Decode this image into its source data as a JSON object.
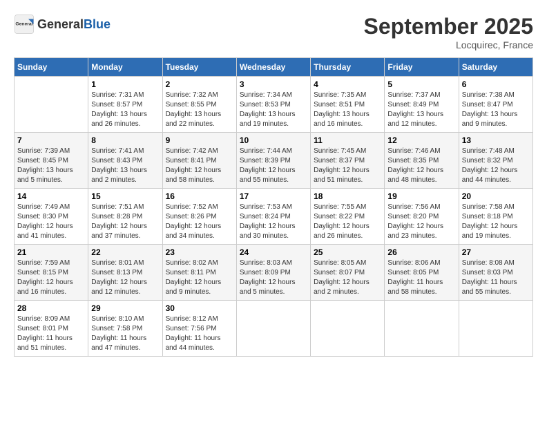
{
  "header": {
    "logo_general": "General",
    "logo_blue": "Blue",
    "month_title": "September 2025",
    "location": "Locquirec, France"
  },
  "days_of_week": [
    "Sunday",
    "Monday",
    "Tuesday",
    "Wednesday",
    "Thursday",
    "Friday",
    "Saturday"
  ],
  "weeks": [
    [
      {
        "day": "",
        "sunrise": "",
        "sunset": "",
        "daylight": ""
      },
      {
        "day": "1",
        "sunrise": "Sunrise: 7:31 AM",
        "sunset": "Sunset: 8:57 PM",
        "daylight": "Daylight: 13 hours and 26 minutes."
      },
      {
        "day": "2",
        "sunrise": "Sunrise: 7:32 AM",
        "sunset": "Sunset: 8:55 PM",
        "daylight": "Daylight: 13 hours and 22 minutes."
      },
      {
        "day": "3",
        "sunrise": "Sunrise: 7:34 AM",
        "sunset": "Sunset: 8:53 PM",
        "daylight": "Daylight: 13 hours and 19 minutes."
      },
      {
        "day": "4",
        "sunrise": "Sunrise: 7:35 AM",
        "sunset": "Sunset: 8:51 PM",
        "daylight": "Daylight: 13 hours and 16 minutes."
      },
      {
        "day": "5",
        "sunrise": "Sunrise: 7:37 AM",
        "sunset": "Sunset: 8:49 PM",
        "daylight": "Daylight: 13 hours and 12 minutes."
      },
      {
        "day": "6",
        "sunrise": "Sunrise: 7:38 AM",
        "sunset": "Sunset: 8:47 PM",
        "daylight": "Daylight: 13 hours and 9 minutes."
      }
    ],
    [
      {
        "day": "7",
        "sunrise": "Sunrise: 7:39 AM",
        "sunset": "Sunset: 8:45 PM",
        "daylight": "Daylight: 13 hours and 5 minutes."
      },
      {
        "day": "8",
        "sunrise": "Sunrise: 7:41 AM",
        "sunset": "Sunset: 8:43 PM",
        "daylight": "Daylight: 13 hours and 2 minutes."
      },
      {
        "day": "9",
        "sunrise": "Sunrise: 7:42 AM",
        "sunset": "Sunset: 8:41 PM",
        "daylight": "Daylight: 12 hours and 58 minutes."
      },
      {
        "day": "10",
        "sunrise": "Sunrise: 7:44 AM",
        "sunset": "Sunset: 8:39 PM",
        "daylight": "Daylight: 12 hours and 55 minutes."
      },
      {
        "day": "11",
        "sunrise": "Sunrise: 7:45 AM",
        "sunset": "Sunset: 8:37 PM",
        "daylight": "Daylight: 12 hours and 51 minutes."
      },
      {
        "day": "12",
        "sunrise": "Sunrise: 7:46 AM",
        "sunset": "Sunset: 8:35 PM",
        "daylight": "Daylight: 12 hours and 48 minutes."
      },
      {
        "day": "13",
        "sunrise": "Sunrise: 7:48 AM",
        "sunset": "Sunset: 8:32 PM",
        "daylight": "Daylight: 12 hours and 44 minutes."
      }
    ],
    [
      {
        "day": "14",
        "sunrise": "Sunrise: 7:49 AM",
        "sunset": "Sunset: 8:30 PM",
        "daylight": "Daylight: 12 hours and 41 minutes."
      },
      {
        "day": "15",
        "sunrise": "Sunrise: 7:51 AM",
        "sunset": "Sunset: 8:28 PM",
        "daylight": "Daylight: 12 hours and 37 minutes."
      },
      {
        "day": "16",
        "sunrise": "Sunrise: 7:52 AM",
        "sunset": "Sunset: 8:26 PM",
        "daylight": "Daylight: 12 hours and 34 minutes."
      },
      {
        "day": "17",
        "sunrise": "Sunrise: 7:53 AM",
        "sunset": "Sunset: 8:24 PM",
        "daylight": "Daylight: 12 hours and 30 minutes."
      },
      {
        "day": "18",
        "sunrise": "Sunrise: 7:55 AM",
        "sunset": "Sunset: 8:22 PM",
        "daylight": "Daylight: 12 hours and 26 minutes."
      },
      {
        "day": "19",
        "sunrise": "Sunrise: 7:56 AM",
        "sunset": "Sunset: 8:20 PM",
        "daylight": "Daylight: 12 hours and 23 minutes."
      },
      {
        "day": "20",
        "sunrise": "Sunrise: 7:58 AM",
        "sunset": "Sunset: 8:18 PM",
        "daylight": "Daylight: 12 hours and 19 minutes."
      }
    ],
    [
      {
        "day": "21",
        "sunrise": "Sunrise: 7:59 AM",
        "sunset": "Sunset: 8:15 PM",
        "daylight": "Daylight: 12 hours and 16 minutes."
      },
      {
        "day": "22",
        "sunrise": "Sunrise: 8:01 AM",
        "sunset": "Sunset: 8:13 PM",
        "daylight": "Daylight: 12 hours and 12 minutes."
      },
      {
        "day": "23",
        "sunrise": "Sunrise: 8:02 AM",
        "sunset": "Sunset: 8:11 PM",
        "daylight": "Daylight: 12 hours and 9 minutes."
      },
      {
        "day": "24",
        "sunrise": "Sunrise: 8:03 AM",
        "sunset": "Sunset: 8:09 PM",
        "daylight": "Daylight: 12 hours and 5 minutes."
      },
      {
        "day": "25",
        "sunrise": "Sunrise: 8:05 AM",
        "sunset": "Sunset: 8:07 PM",
        "daylight": "Daylight: 12 hours and 2 minutes."
      },
      {
        "day": "26",
        "sunrise": "Sunrise: 8:06 AM",
        "sunset": "Sunset: 8:05 PM",
        "daylight": "Daylight: 11 hours and 58 minutes."
      },
      {
        "day": "27",
        "sunrise": "Sunrise: 8:08 AM",
        "sunset": "Sunset: 8:03 PM",
        "daylight": "Daylight: 11 hours and 55 minutes."
      }
    ],
    [
      {
        "day": "28",
        "sunrise": "Sunrise: 8:09 AM",
        "sunset": "Sunset: 8:01 PM",
        "daylight": "Daylight: 11 hours and 51 minutes."
      },
      {
        "day": "29",
        "sunrise": "Sunrise: 8:10 AM",
        "sunset": "Sunset: 7:58 PM",
        "daylight": "Daylight: 11 hours and 47 minutes."
      },
      {
        "day": "30",
        "sunrise": "Sunrise: 8:12 AM",
        "sunset": "Sunset: 7:56 PM",
        "daylight": "Daylight: 11 hours and 44 minutes."
      },
      {
        "day": "",
        "sunrise": "",
        "sunset": "",
        "daylight": ""
      },
      {
        "day": "",
        "sunrise": "",
        "sunset": "",
        "daylight": ""
      },
      {
        "day": "",
        "sunrise": "",
        "sunset": "",
        "daylight": ""
      },
      {
        "day": "",
        "sunrise": "",
        "sunset": "",
        "daylight": ""
      }
    ]
  ]
}
